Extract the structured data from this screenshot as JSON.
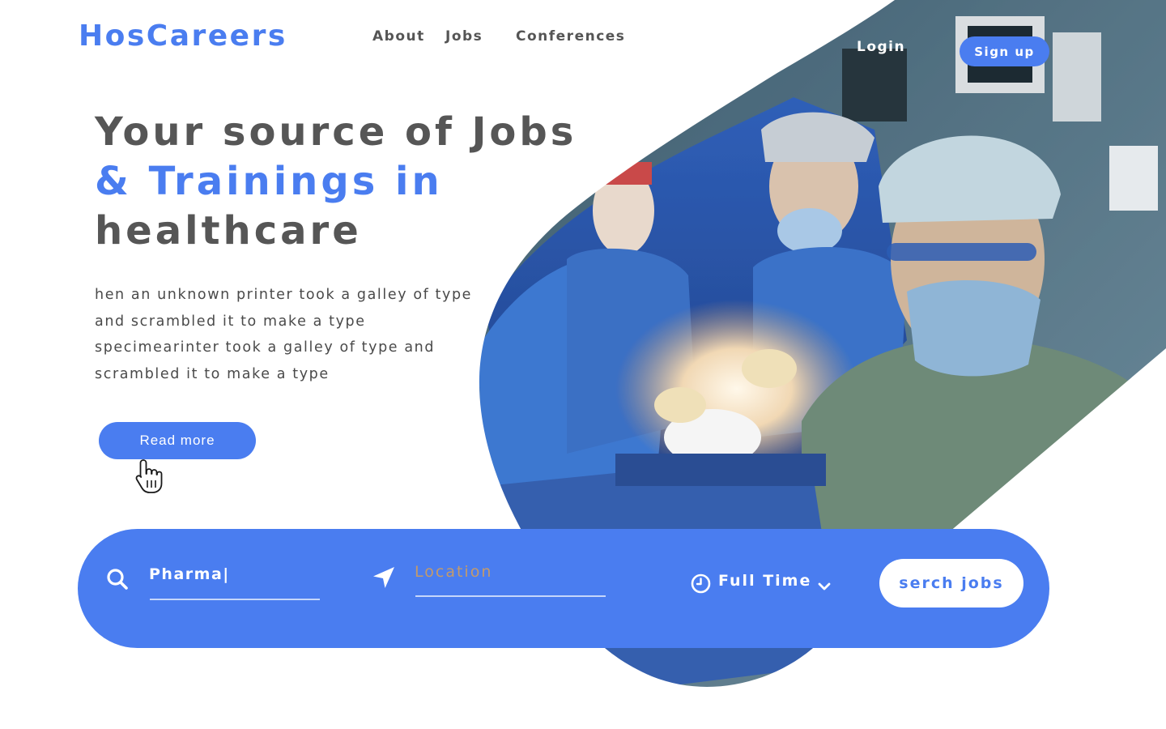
{
  "header": {
    "logo": "HosCareers",
    "nav": [
      {
        "label": "About"
      },
      {
        "label": "Jobs"
      },
      {
        "label": "Conferences"
      }
    ],
    "login_label": "Login",
    "signup_label": "Sign up"
  },
  "hero": {
    "headline_line1": "Your source of Jobs",
    "headline_line2": "& Trainings in",
    "headline_line3": "healthcare",
    "description": "hen an unknown printer took a galley of type and scrambled it to make a type specimearinter took a galley of type and scrambled it to make a type",
    "readmore_label": "Read more",
    "image_subject": "surgeons operating in hospital theatre"
  },
  "search": {
    "keyword_value": "Pharma|",
    "location_placeholder": "Location",
    "job_type_selected": "Full Time",
    "submit_label": "serch jobs"
  },
  "colors": {
    "accent": "#4a7df0",
    "heading": "#565656",
    "body_text": "#4a4a4a",
    "placeholder": "#c39a6b",
    "white": "#ffffff"
  },
  "icons": {
    "search": "search-icon",
    "location": "location-arrow-icon",
    "clock": "clock-icon",
    "dropdown": "chevron-down-icon",
    "cursor": "hand-pointer-icon"
  }
}
